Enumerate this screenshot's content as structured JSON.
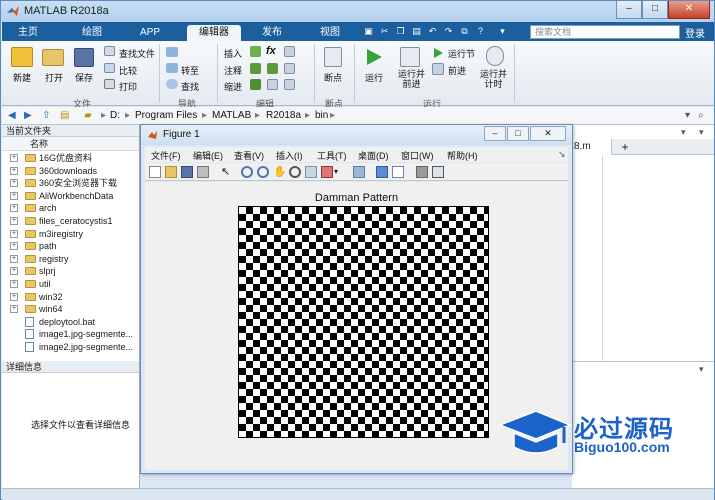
{
  "app": {
    "title": "MATLAB R2018a"
  },
  "tabs": [
    {
      "label": "主页"
    },
    {
      "label": "绘图"
    },
    {
      "label": "APP"
    },
    {
      "label": "编辑器"
    },
    {
      "label": "发布"
    },
    {
      "label": "视图"
    }
  ],
  "search": {
    "placeholder": "搜索文档"
  },
  "login_label": "登录",
  "ribbon": {
    "new": "新建",
    "open": "打开",
    "save": "保存",
    "find_files": "查找文件",
    "compare": "比较",
    "print": "打印",
    "goto": "转至",
    "find": "查找",
    "insert": "插入",
    "comment": "注释",
    "indent": "缩进",
    "breakpoints": "断点",
    "run": "运行",
    "run_advance": "运行并\n前进",
    "run_section": "运行节",
    "advance": "前进",
    "run_time": "运行并\n计时",
    "groups": {
      "file": "文件",
      "nav": "导航",
      "edit": "编辑",
      "breakpoints": "断点",
      "run": "运行"
    }
  },
  "address": {
    "crumbs": [
      "D:",
      "Program Files",
      "MATLAB",
      "R2018a",
      "bin"
    ]
  },
  "current_folder": {
    "title": "当前文件夹",
    "col_name": "名称",
    "items": [
      {
        "name": "16G优盘资料",
        "type": "folder"
      },
      {
        "name": "360downloads",
        "type": "folder"
      },
      {
        "name": "360安全浏览器下载",
        "type": "folder"
      },
      {
        "name": "AliWorkbenchData",
        "type": "folder"
      },
      {
        "name": "arch",
        "type": "folder"
      },
      {
        "name": "files_ceratocystis1",
        "type": "folder"
      },
      {
        "name": "m3iregistry",
        "type": "folder"
      },
      {
        "name": "path",
        "type": "folder"
      },
      {
        "name": "registry",
        "type": "folder"
      },
      {
        "name": "slprj",
        "type": "folder"
      },
      {
        "name": "util",
        "type": "folder"
      },
      {
        "name": "win32",
        "type": "folder"
      },
      {
        "name": "win64",
        "type": "folder"
      },
      {
        "name": "deploytool.bat",
        "type": "file"
      },
      {
        "name": "image1.jpg-segmente...",
        "type": "file"
      },
      {
        "name": "image2.jpg-segmente...",
        "type": "file"
      }
    ]
  },
  "details": {
    "title": "详细信息",
    "message": "选择文件以查看详细信息"
  },
  "editor_tab": {
    "label": "8.m",
    "plus": "+"
  },
  "figure": {
    "title": "Figure 1",
    "menus": [
      "文件(F)",
      "编辑(E)",
      "查看(V)",
      "插入(I)",
      "工具(T)",
      "桌面(D)",
      "窗口(W)",
      "帮助(H)"
    ],
    "plot_title": "Damman Pattern"
  },
  "watermark": {
    "cn": "必过源码",
    "en": "Biguo100.com"
  }
}
